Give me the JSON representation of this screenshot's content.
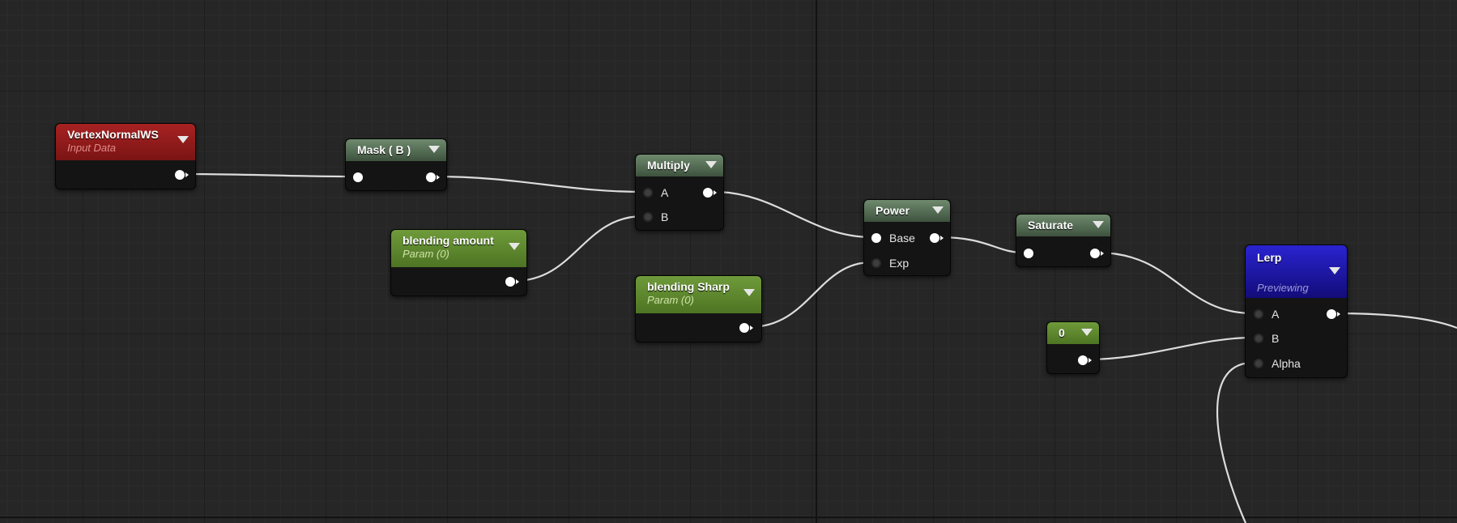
{
  "graph": {
    "nodes": [
      {
        "id": "vertex_normal_ws",
        "title": "VertexNormalWS",
        "subtitle": "Input Data",
        "color": "#a82222"
      },
      {
        "id": "mask_b",
        "title": "Mask ( B )",
        "subtitle": "",
        "color": "#5a725a"
      },
      {
        "id": "blending_amount",
        "title": "blending amount",
        "subtitle": "Param (0)",
        "color": "#6f9b3a"
      },
      {
        "id": "multiply",
        "title": "Multiply",
        "subtitle": "",
        "color": "#5a725a",
        "inputs": [
          "A",
          "B"
        ]
      },
      {
        "id": "blending_sharp",
        "title": "blending Sharp",
        "subtitle": "Param (0)",
        "color": "#6f9b3a"
      },
      {
        "id": "power",
        "title": "Power",
        "subtitle": "",
        "color": "#5a725a",
        "inputs": [
          "Base",
          "Exp"
        ]
      },
      {
        "id": "saturate",
        "title": "Saturate",
        "subtitle": "",
        "color": "#5a725a"
      },
      {
        "id": "constant_zero",
        "title": "0",
        "subtitle": "",
        "color": "#6f9b3a"
      },
      {
        "id": "lerp",
        "title": "Lerp",
        "subtitle": "Previewing",
        "color": "#2a23d0",
        "inputs": [
          "A",
          "B",
          "Alpha"
        ]
      }
    ]
  }
}
